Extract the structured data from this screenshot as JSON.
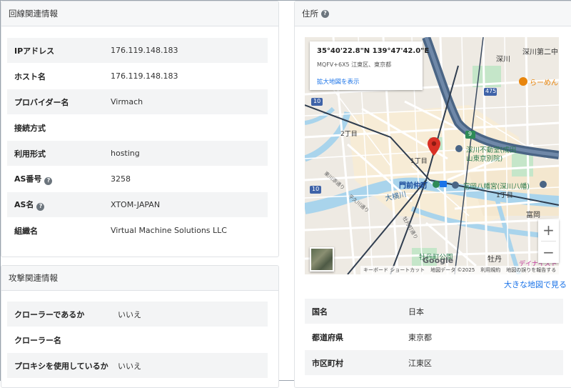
{
  "line_info": {
    "header": "回線関連情報",
    "rows": [
      {
        "key": "IPアドレス",
        "value": "176.119.148.183",
        "help": false
      },
      {
        "key": "ホスト名",
        "value": "176.119.148.183",
        "help": false
      },
      {
        "key": "プロバイダー名",
        "value": "Virmach",
        "help": false
      },
      {
        "key": "接続方式",
        "value": "",
        "help": false
      },
      {
        "key": "利用形式",
        "value": "hosting",
        "help": false
      },
      {
        "key": "AS番号",
        "value": "3258",
        "help": true
      },
      {
        "key": "AS名",
        "value": "XTOM-JAPAN",
        "help": true
      },
      {
        "key": "組織名",
        "value": "Virtual Machine Solutions LLC",
        "help": false
      }
    ]
  },
  "attack_info": {
    "header": "攻撃関連情報",
    "rows": [
      {
        "key": "クローラーであるか",
        "value": "いいえ"
      },
      {
        "key": "クローラー名",
        "value": ""
      },
      {
        "key": "プロキシを使用しているか",
        "value": "いいえ"
      }
    ]
  },
  "address": {
    "header": "住所",
    "help_icon": "question-circle-icon",
    "map": {
      "coords": "35°40'22.8\"N 139°47'42.0\"E",
      "plus_code": "MQFV+6X5 江東区、東京都",
      "enlarge_link": "拡大地図を表示",
      "zoom_in": "+",
      "zoom_out": "−",
      "google_logo": "Google",
      "attribution": [
        "キーボード ショートカット",
        "地図データ ©2025",
        "利用規約",
        "地図の誤りを報告する"
      ],
      "labels": {
        "fukagawa": "深川",
        "fukagawa2": "深川第二中",
        "ramen": "らーめん",
        "route475": "475",
        "route10a": "10",
        "route10b": "10",
        "route9": "9",
        "chome2": "2丁目",
        "chome1": "1丁目",
        "chome1b": "1丁目",
        "fudoson": "深川不動堂(成田",
        "fudoson2": "山東京別院)",
        "monzen": "門前仲町",
        "hachimangu": "富岡八幡宮(深川八幡)",
        "ohyokogawa": "大横川",
        "tomioka": "富岡",
        "botan": "牡丹",
        "botan_park": "牡丹町公園",
        "fukagawa_street": "東川添通り",
        "yokogawa_street": "平久川通り",
        "botan_street": "牡丹町通り",
        "daiei": "デイナイスト"
      }
    },
    "big_map_link": "大きな地図で見る",
    "rows": [
      {
        "key": "国名",
        "value": "日本"
      },
      {
        "key": "都道府県",
        "value": "東京都"
      },
      {
        "key": "市区町村",
        "value": "江東区"
      }
    ]
  },
  "colors": {
    "link": "#1a73e8",
    "pin": "#d93025",
    "highway": "#4a6585",
    "water": "#a9d4ec",
    "park": "#c5e6c9"
  }
}
